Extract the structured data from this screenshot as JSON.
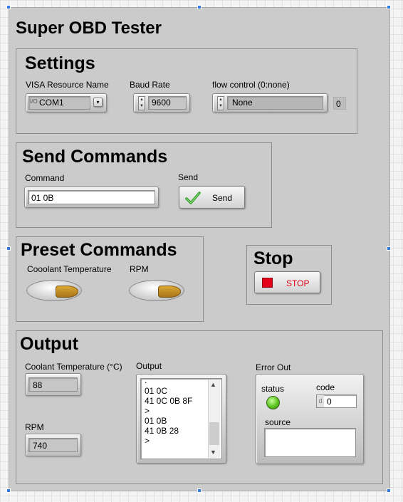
{
  "title": "Super OBD Tester",
  "settings": {
    "heading": "Settings",
    "visa_label": "VISA Resource Name",
    "visa_value": "COM1",
    "visa_prefix": "I/O",
    "baud_label": "Baud Rate",
    "baud_value": "9600",
    "flow_label": "flow control (0:none)",
    "flow_value": "None",
    "flow_numeric": "0"
  },
  "send": {
    "heading": "Send Commands",
    "command_label": "Command",
    "command_value": "01 0B",
    "send_label": "Send",
    "send_button": "Send"
  },
  "preset": {
    "heading": "Preset Commands",
    "coolant_label": "Cooolant Temperature",
    "rpm_label": "RPM"
  },
  "stop": {
    "heading": "Stop",
    "button": "STOP"
  },
  "output": {
    "heading": "Output",
    "coolant_label": "Coolant Temperature (°C)",
    "coolant_value": "88",
    "rpm_label": "RPM",
    "rpm_value": "740",
    "log_label": "Output",
    "log_lines": [
      ".",
      "01 0C",
      "41 0C 0B 8F",
      ">",
      "01 0B",
      "41 0B 28",
      ">"
    ],
    "error": {
      "label": "Error Out",
      "status_label": "status",
      "code_label": "code",
      "code_prefix": "d",
      "code_value": "0",
      "source_label": "source",
      "status_color": "#5cc41f"
    }
  }
}
